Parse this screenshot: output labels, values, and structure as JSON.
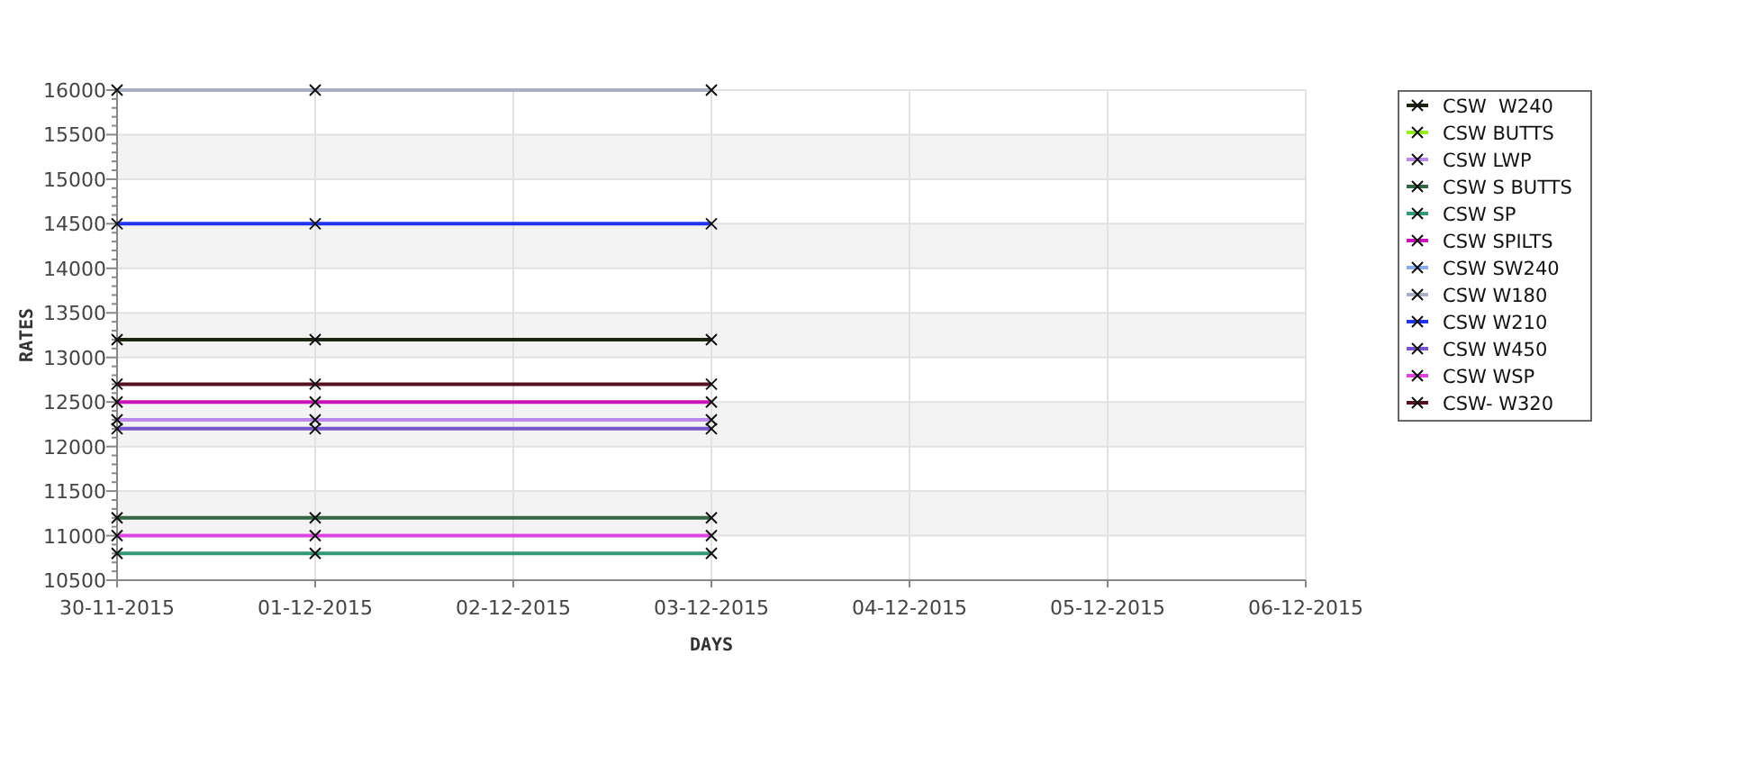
{
  "chart_data": {
    "type": "line",
    "xlabel": "DAYS",
    "ylabel": "RATES",
    "categories": [
      "30-11-2015",
      "01-12-2015",
      "02-12-2015",
      "03-12-2015",
      "04-12-2015",
      "05-12-2015",
      "06-12-2015"
    ],
    "ylim": [
      10500,
      16000
    ],
    "grid": true,
    "legend": true,
    "yticks": [
      10500,
      11000,
      11500,
      12000,
      12500,
      13000,
      13500,
      14000,
      14500,
      15000,
      15500,
      16000
    ],
    "series": [
      {
        "name": "CSW  W240",
        "color": "#1c2414",
        "values": [
          13200,
          13200,
          null,
          13200,
          null,
          null,
          null
        ]
      },
      {
        "name": "CSW BUTTS",
        "color": "#99ee22",
        "values": [
          null,
          null,
          null,
          null,
          null,
          null,
          null
        ]
      },
      {
        "name": "CSW LWP",
        "color": "#bb88ee",
        "values": [
          12300,
          12300,
          null,
          12300,
          null,
          null,
          null
        ]
      },
      {
        "name": "CSW S BUTTS",
        "color": "#336644",
        "values": [
          11200,
          11200,
          null,
          11200,
          null,
          null,
          null
        ]
      },
      {
        "name": "CSW SP",
        "color": "#339977",
        "values": [
          10800,
          10800,
          null,
          10800,
          null,
          null,
          null
        ]
      },
      {
        "name": "CSW SPILTS",
        "color": "#cc11bb",
        "values": [
          12500,
          12500,
          null,
          12500,
          null,
          null,
          null
        ]
      },
      {
        "name": "CSW SW240",
        "color": "#88aaee",
        "values": [
          null,
          null,
          null,
          null,
          null,
          null,
          null
        ]
      },
      {
        "name": "CSW W180",
        "color": "#aab0c4",
        "values": [
          16000,
          16000,
          null,
          16000,
          null,
          null,
          null
        ]
      },
      {
        "name": "CSW W210",
        "color": "#2233ee",
        "values": [
          14500,
          14500,
          null,
          14500,
          null,
          null,
          null
        ]
      },
      {
        "name": "CSW W450",
        "color": "#7755cc",
        "values": [
          12200,
          12200,
          null,
          12200,
          null,
          null,
          null
        ]
      },
      {
        "name": "CSW WSP",
        "color": "#dd44dd",
        "values": [
          11000,
          11000,
          null,
          11000,
          null,
          null,
          null
        ]
      },
      {
        "name": "CSW- W320",
        "color": "#551122",
        "values": [
          12700,
          12700,
          null,
          12700,
          null,
          null,
          null
        ]
      }
    ]
  }
}
